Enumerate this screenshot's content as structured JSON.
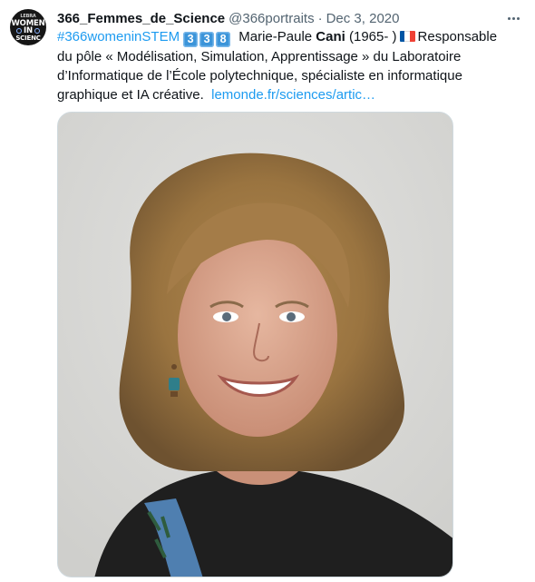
{
  "tweet": {
    "author": {
      "display_name": "366_Femmes_de_Science",
      "handle": "@366portraits",
      "avatar_text": [
        "LEBRA",
        "WOMEN",
        "IN",
        "SCIENC"
      ]
    },
    "separator": "·",
    "date": "Dec 3, 2020",
    "text": {
      "hashtag": "#366womeninSTEM",
      "keycaps": [
        "3",
        "3",
        "8"
      ],
      "name_first": "Marie-Paule",
      "name_last": "Cani",
      "years": "(1965- )",
      "flag_icon": "france-flag-icon",
      "line1_tail": "Responsable",
      "line2": "du pôle « Modélisation, Simulation, Apprentissage » du Laboratoire",
      "line3": "d’Informatique de l’École polytechnique, spécialiste en informatique",
      "line4": "graphique et IA créative.",
      "link": "lemonde.fr/sciences/artic…"
    },
    "colors": {
      "link": "#1d9bf0",
      "secondary_text": "#536471",
      "keycap": "#3b94d9",
      "flag": [
        "#0055a4",
        "#ffffff",
        "#ef4135"
      ]
    }
  }
}
